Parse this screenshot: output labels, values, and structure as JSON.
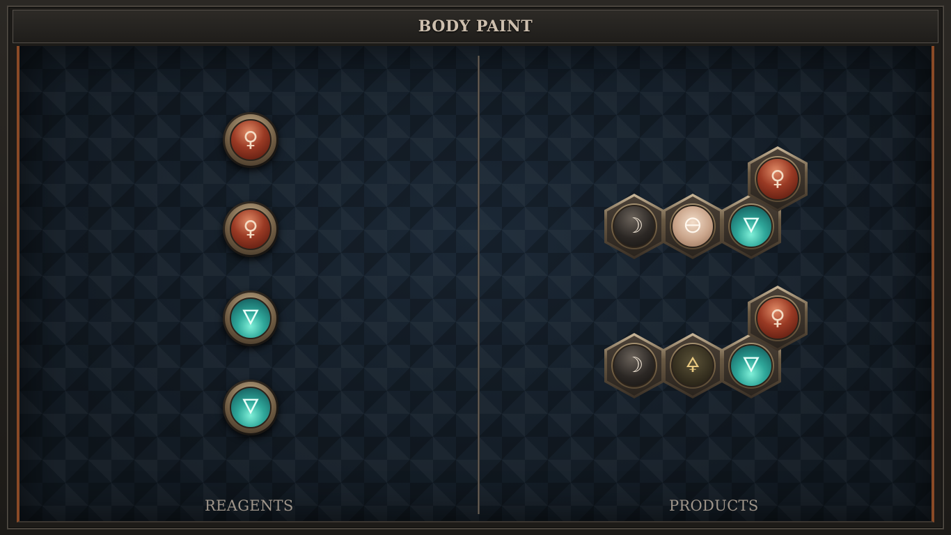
{
  "header": {
    "title": "BODY PAINT"
  },
  "reagents": {
    "label": "REAGENTS",
    "items": [
      {
        "element": "copper",
        "glyph": "♀",
        "icon": "venus-copper-icon"
      },
      {
        "element": "copper",
        "glyph": "♀",
        "icon": "venus-copper-icon"
      },
      {
        "element": "water",
        "glyph": "🜄",
        "icon": "water-triangle-icon"
      },
      {
        "element": "water",
        "glyph": "🜄",
        "icon": "water-triangle-icon"
      }
    ]
  },
  "products": {
    "label": "PRODUCTS",
    "molecules": [
      {
        "atoms": [
          {
            "element": "silver",
            "glyph": "☽"
          },
          {
            "element": "salt",
            "glyph": "🜔"
          },
          {
            "element": "water",
            "glyph": "🜄"
          },
          {
            "element": "copper",
            "glyph": "♀"
          }
        ]
      },
      {
        "atoms": [
          {
            "element": "silver",
            "glyph": "☽"
          },
          {
            "element": "sulfur",
            "glyph": "🜍"
          },
          {
            "element": "water",
            "glyph": "🜄"
          },
          {
            "element": "copper",
            "glyph": "♀"
          }
        ]
      }
    ]
  },
  "colors": {
    "copper": "#9a3a24",
    "water": "#2fa79a",
    "silver": "#2c2825",
    "salt": "#c9a48a",
    "frame_accent": "#8a4a26"
  }
}
